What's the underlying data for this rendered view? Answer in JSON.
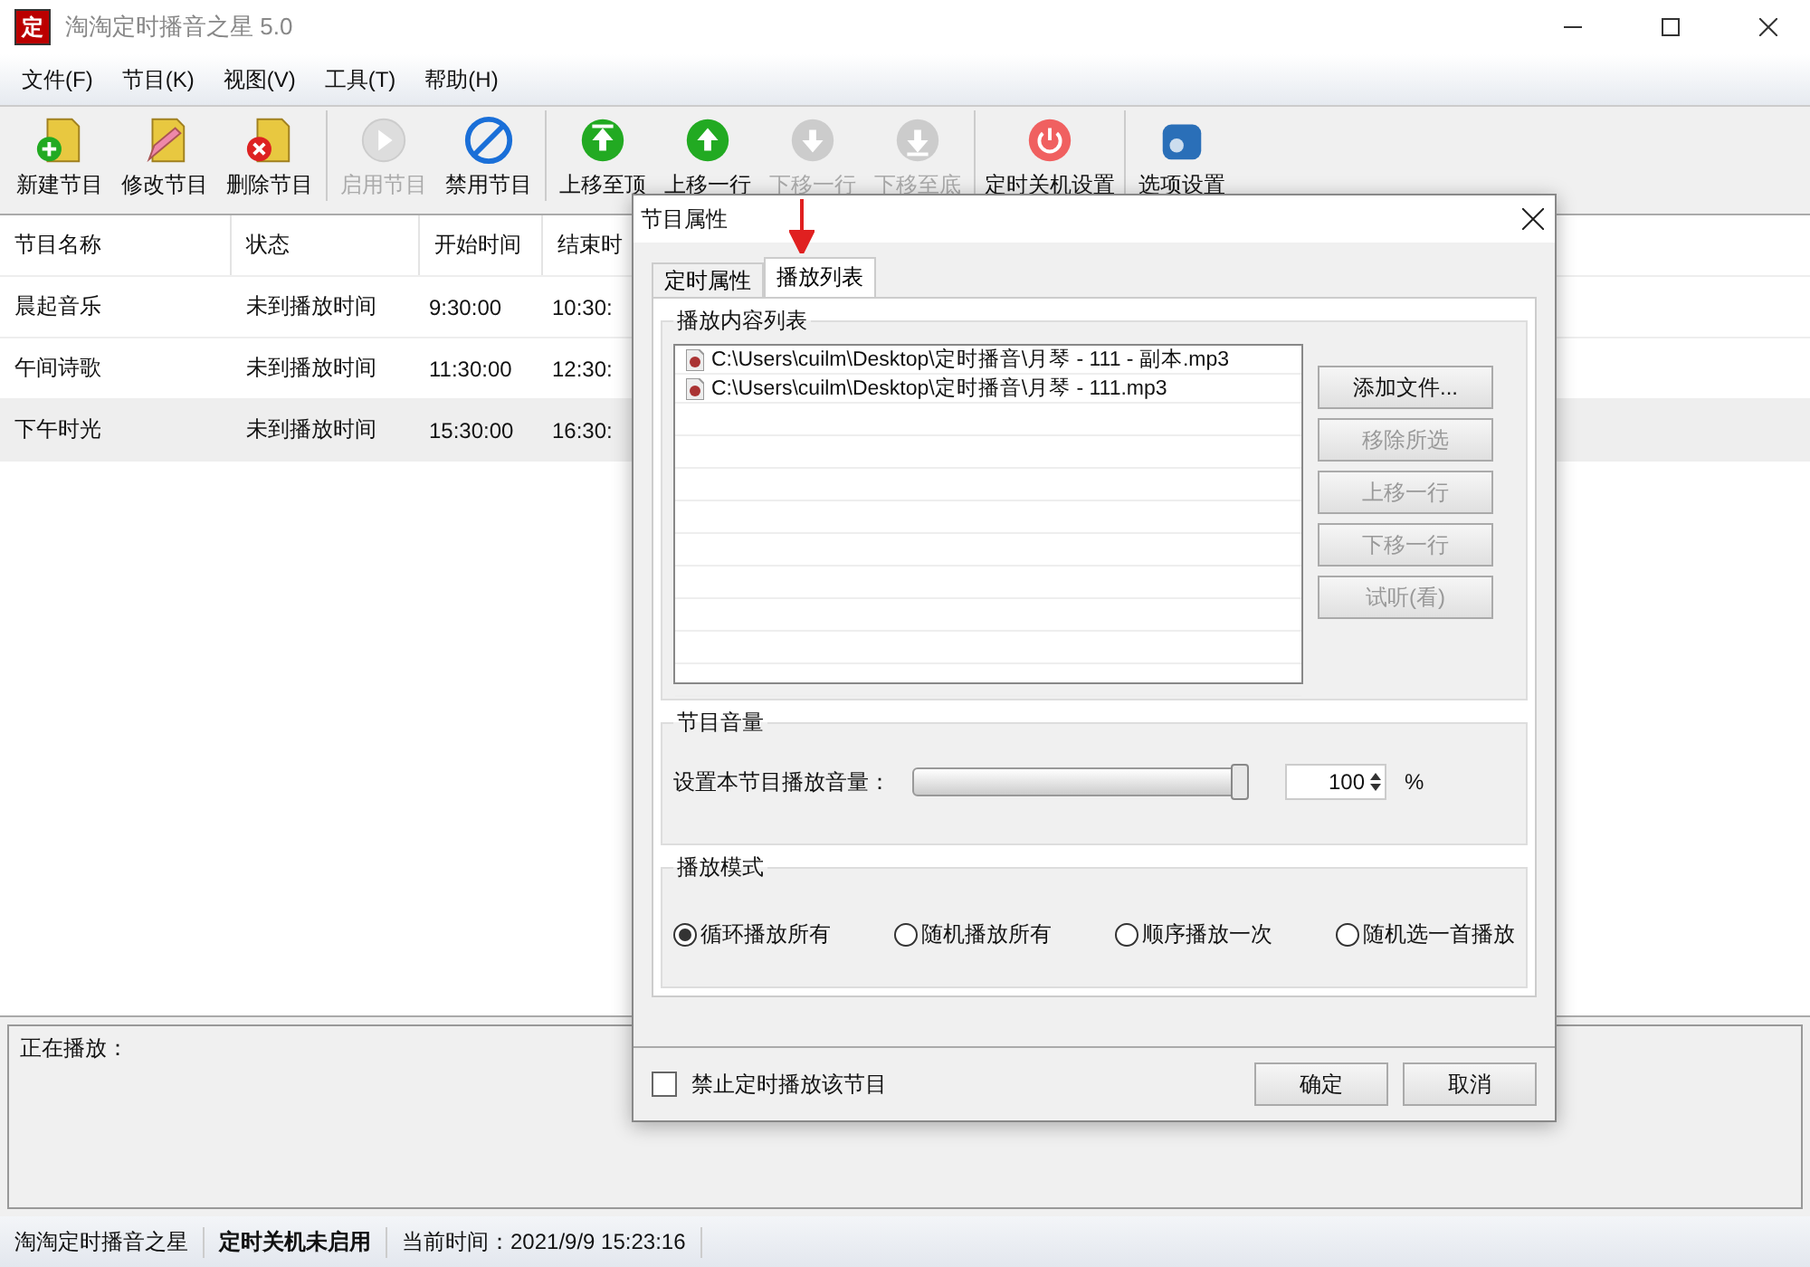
{
  "window": {
    "logo": "定",
    "title": "淘淘定时播音之星 5.0"
  },
  "menu": [
    "文件(F)",
    "节目(K)",
    "视图(V)",
    "工具(T)",
    "帮助(H)"
  ],
  "toolbar": [
    [
      {
        "kind": "add",
        "label": "新建节目",
        "disabled": false
      },
      {
        "kind": "edit",
        "label": "修改节目",
        "disabled": false
      },
      {
        "kind": "delete",
        "label": "删除节目",
        "disabled": false
      }
    ],
    [
      {
        "kind": "play",
        "label": "启用节目",
        "disabled": true
      },
      {
        "kind": "ban",
        "label": "禁用节目",
        "disabled": false
      }
    ],
    [
      {
        "kind": "top",
        "label": "上移至顶",
        "disabled": false
      },
      {
        "kind": "up",
        "label": "上移一行",
        "disabled": false
      },
      {
        "kind": "down",
        "label": "下移一行",
        "disabled": true
      },
      {
        "kind": "bottom",
        "label": "下移至底",
        "disabled": true
      }
    ],
    [
      {
        "kind": "power",
        "label": "定时关机设置",
        "disabled": false
      }
    ],
    [
      {
        "kind": "settings",
        "label": "选项设置",
        "disabled": false
      }
    ]
  ],
  "table": {
    "columns": [
      "节目名称",
      "状态",
      "开始时间",
      "结束时"
    ],
    "rows": [
      {
        "cells": [
          "晨起音乐",
          "未到播放时间",
          "9:30:00",
          "10:30:"
        ],
        "selected": false
      },
      {
        "cells": [
          "午间诗歌",
          "未到播放时间",
          "11:30:00",
          "12:30:"
        ],
        "selected": false
      },
      {
        "cells": [
          "下午时光",
          "未到播放时间",
          "15:30:00",
          "16:30:"
        ],
        "selected": true
      }
    ]
  },
  "now_playing": {
    "label": "正在播放："
  },
  "status_bar": [
    {
      "text": "淘淘定时播音之星",
      "bold": false
    },
    {
      "text": "定时关机未启用",
      "bold": true
    },
    {
      "text": "当前时间：2021/9/9 15:23:16",
      "bold": false
    }
  ],
  "dialog": {
    "title": "节目属性",
    "tabs": [
      {
        "label": "定时属性",
        "selected": false
      },
      {
        "label": "播放列表",
        "selected": true
      }
    ],
    "playlist": {
      "title": "播放内容列表",
      "files": [
        "C:\\Users\\cuilm\\Desktop\\定时播音\\月琴 - 111 - 副本.mp3",
        "C:\\Users\\cuilm\\Desktop\\定时播音\\月琴 - 111.mp3"
      ],
      "buttons": [
        {
          "label": "添加文件...",
          "disabled": false
        },
        {
          "label": "移除所选",
          "disabled": true
        },
        {
          "label": "上移一行",
          "disabled": true
        },
        {
          "label": "下移一行",
          "disabled": true
        },
        {
          "label": "试听(看)",
          "disabled": true
        }
      ]
    },
    "volume": {
      "title": "节目音量",
      "label": "设置本节目播放音量：",
      "level": 1,
      "value": "100",
      "unit": "%"
    },
    "mode": {
      "title": "播放模式",
      "options": [
        {
          "label": "循环播放所有",
          "selected": true
        },
        {
          "label": "随机播放所有",
          "selected": false
        },
        {
          "label": "顺序播放一次",
          "selected": false
        },
        {
          "label": "随机选一首播放",
          "selected": false
        }
      ]
    },
    "disable": {
      "label": "禁止定时播放该节目",
      "checked": false
    },
    "buttons": [
      "确定",
      "取消"
    ]
  }
}
